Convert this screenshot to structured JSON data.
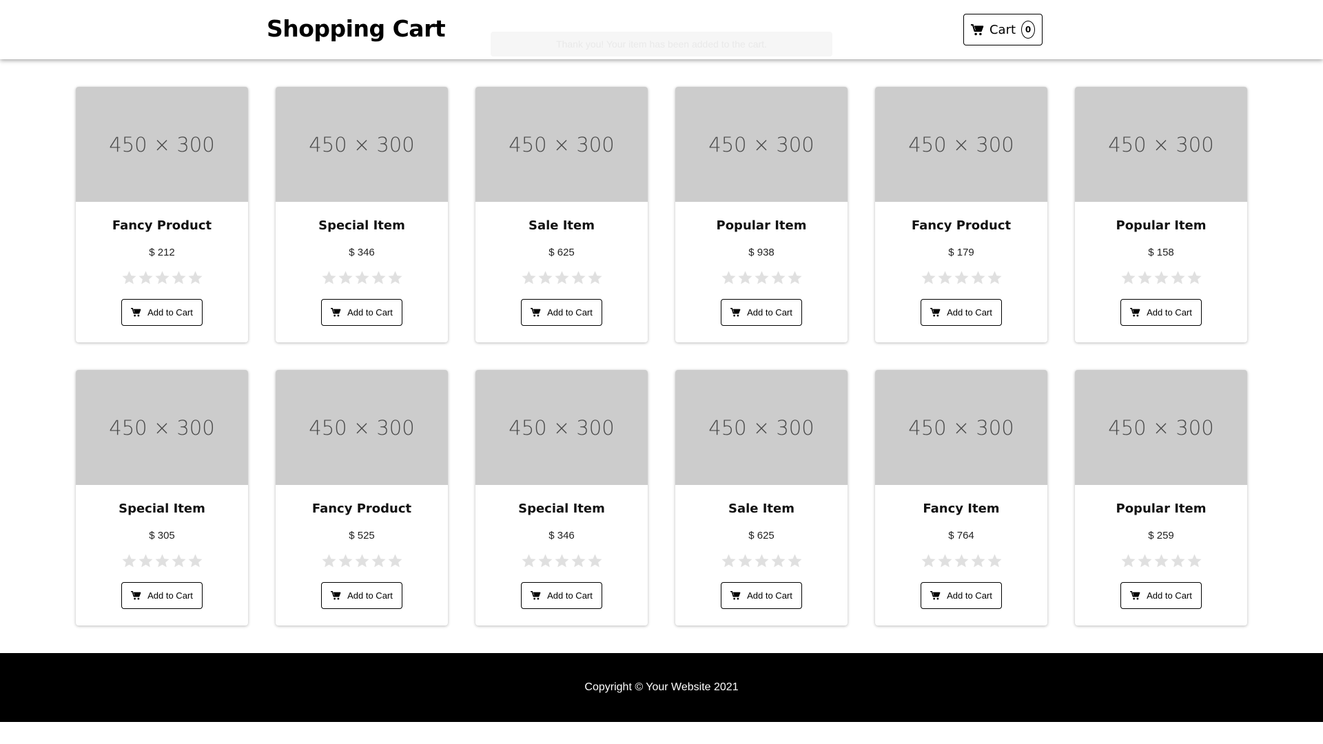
{
  "header": {
    "title": "Shopping Cart",
    "toast_text": "Thank you! Your item has been added to the cart.",
    "cart_label": "Cart",
    "cart_count": "0"
  },
  "colors": {
    "image_placeholder": "#cccccc",
    "star_empty": "#e0e0e0",
    "footer_bg": "#000000",
    "footer_text": "#ffffff"
  },
  "icons": {
    "cart": "shopping-cart-icon",
    "star": "star-icon"
  },
  "products": [
    {
      "image_label": "450 × 300",
      "name": "Fancy Product",
      "price": "$ 212",
      "rating": 0,
      "button_label": "Add to Cart"
    },
    {
      "image_label": "450 × 300",
      "name": "Special Item",
      "price": "$ 346",
      "rating": 0,
      "button_label": "Add to Cart"
    },
    {
      "image_label": "450 × 300",
      "name": "Sale Item",
      "price": "$ 625",
      "rating": 0,
      "button_label": "Add to Cart"
    },
    {
      "image_label": "450 × 300",
      "name": "Popular Item",
      "price": "$ 938",
      "rating": 0,
      "button_label": "Add to Cart"
    },
    {
      "image_label": "450 × 300",
      "name": "Fancy Product",
      "price": "$ 179",
      "rating": 0,
      "button_label": "Add to Cart"
    },
    {
      "image_label": "450 × 300",
      "name": "Popular Item",
      "price": "$ 158",
      "rating": 0,
      "button_label": "Add to Cart"
    },
    {
      "image_label": "450 × 300",
      "name": "Special Item",
      "price": "$ 305",
      "rating": 0,
      "button_label": "Add to Cart"
    },
    {
      "image_label": "450 × 300",
      "name": "Fancy Product",
      "price": "$ 525",
      "rating": 0,
      "button_label": "Add to Cart"
    },
    {
      "image_label": "450 × 300",
      "name": "Special Item",
      "price": "$ 346",
      "rating": 0,
      "button_label": "Add to Cart"
    },
    {
      "image_label": "450 × 300",
      "name": "Sale Item",
      "price": "$ 625",
      "rating": 0,
      "button_label": "Add to Cart"
    },
    {
      "image_label": "450 × 300",
      "name": "Fancy Item",
      "price": "$ 764",
      "rating": 0,
      "button_label": "Add to Cart"
    },
    {
      "image_label": "450 × 300",
      "name": "Popular Item",
      "price": "$ 259",
      "rating": 0,
      "button_label": "Add to Cart"
    }
  ],
  "footer": {
    "copyright": "Copyright © Your Website 2021"
  }
}
